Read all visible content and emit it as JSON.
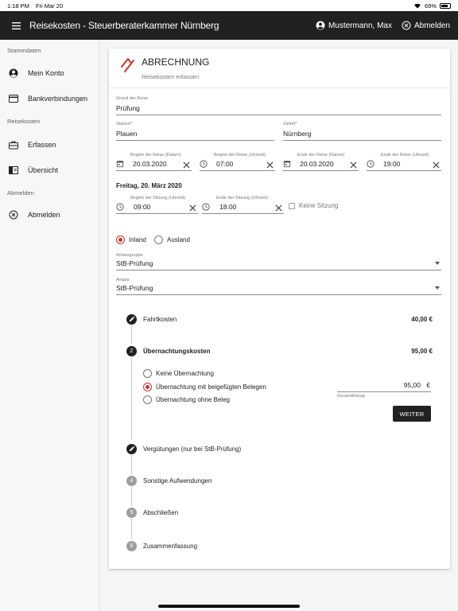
{
  "status": {
    "time": "1:18 PM",
    "date": "Fri Mar 20",
    "battery": "69%"
  },
  "appbar": {
    "title": "Reisekosten - Steuerberaterkammer Nürnberg",
    "user": "Mustermann, Max",
    "logout": "Abmelden"
  },
  "sidebar": {
    "sections": [
      {
        "label": "Stammdaten",
        "items": [
          {
            "label": "Mein Konto",
            "icon": "account-circle-icon"
          },
          {
            "label": "Bankverbindungen",
            "icon": "credit-card-icon"
          }
        ]
      },
      {
        "label": "Reisekosten",
        "items": [
          {
            "label": "Erfassen",
            "icon": "briefcase-icon"
          },
          {
            "label": "Übersicht",
            "icon": "list-book-icon"
          }
        ]
      },
      {
        "label": "Abmelden",
        "items": [
          {
            "label": "Abmelden",
            "icon": "close-circle-icon"
          }
        ]
      }
    ]
  },
  "card": {
    "title": "ABRECHNUNG",
    "subtitle": "Reisekosten erfassen",
    "grund": {
      "label": "Grund der Reise",
      "value": "Prüfung"
    },
    "startort": {
      "label": "Startort*",
      "value": "Plauen"
    },
    "zielort": {
      "label": "Zielort*",
      "value": "Nürnberg"
    },
    "beginn_datum": {
      "label": "Beginn der Reise (Datum)",
      "value": "20.03.2020"
    },
    "beginn_zeit": {
      "label": "Beginn der Reise (Uhrzeit)",
      "value": "07:00"
    },
    "ende_datum": {
      "label": "Ende der Reise (Datum)",
      "value": "20.03.2020"
    },
    "ende_zeit": {
      "label": "Ende der Reise (Uhrzeit)",
      "value": "19:00"
    },
    "day_heading": "Freitag, 20. März 2020",
    "sitzung_beginn": {
      "label": "Beginn der Sitzung (Uhrzeit)",
      "value": "09:00"
    },
    "sitzung_ende": {
      "label": "Ende der Sitzung (Uhrzeit)",
      "value": "18:00"
    },
    "keine_sitzung": "Keine Sitzung",
    "inland": "Inland",
    "ausland": "Ausland",
    "anlassgruppe": {
      "label": "Anlassgruppe",
      "value": "StB-Prüfung"
    },
    "anlass": {
      "label": "Anlass",
      "value": "StB-Prüfung"
    }
  },
  "steps": [
    {
      "num": "",
      "label": "Fahrtkosten",
      "amount": "40,00 €"
    },
    {
      "num": "2",
      "label": "Übernachtungskosten",
      "amount": "95,00 €"
    },
    {
      "num": "",
      "label": "Vergütungen (nur bei StB-Prüfung)",
      "amount": ""
    },
    {
      "num": "4",
      "label": "Sonstige Aufwendungen",
      "amount": ""
    },
    {
      "num": "5",
      "label": "Abschließen",
      "amount": ""
    },
    {
      "num": "6",
      "label": "Zusammenfassung",
      "amount": ""
    }
  ],
  "uebernachtung": {
    "options": [
      "Keine Übernachtung",
      "Übernachtung mit beigefügten Belegen",
      "Übernachtung ohne Beleg"
    ],
    "amount": "95,00",
    "currency": "€",
    "hint": "Gesamtbetrag",
    "weiter": "WEITER"
  },
  "colors": {
    "accent": "#d32f2f",
    "appbar": "#212121"
  }
}
